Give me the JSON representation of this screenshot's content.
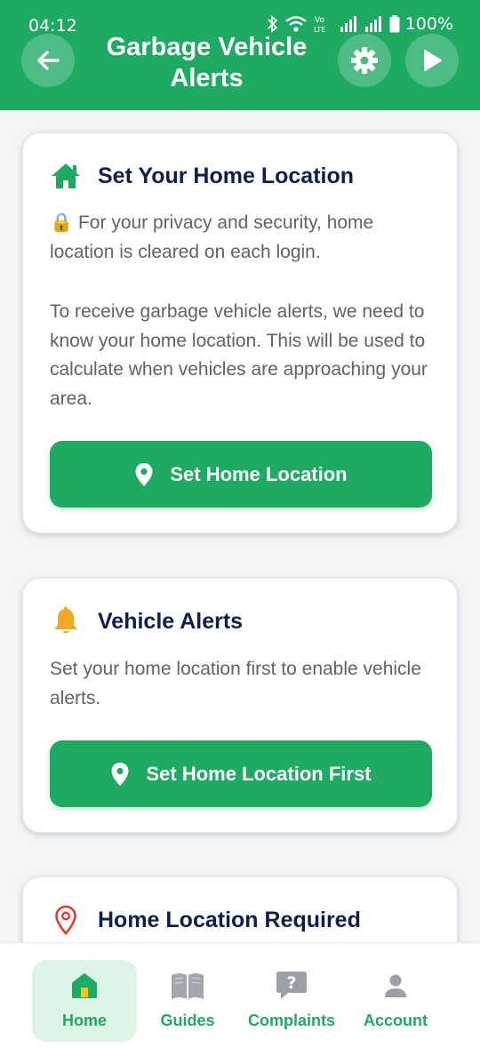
{
  "status_bar": {
    "time": "04:12",
    "battery": "100%",
    "icons": [
      "bluetooth-icon",
      "wifi-icon",
      "volte-icon",
      "signal-icon",
      "signal-icon",
      "battery-icon"
    ]
  },
  "header": {
    "title": "Garbage Vehicle Alerts",
    "back_icon": "arrow-left-icon",
    "settings_icon": "gear-icon",
    "play_icon": "play-icon",
    "background": "#1faa63"
  },
  "cards": {
    "home_location": {
      "icon": "home-icon",
      "title": "Set Your Home Location",
      "privacy_text": "🔒 For your privacy and security, home location is cleared on each login.",
      "description": "To receive garbage vehicle alerts, we need to know your home location. This will be used to calculate when vehicles are approaching your area.",
      "button_label": "Set Home Location"
    },
    "vehicle_alerts": {
      "icon": "bell-icon",
      "icon_color": "#f5a623",
      "title": "Vehicle Alerts",
      "description": "Set your home location first to enable vehicle alerts.",
      "button_label": "Set Home Location First"
    },
    "location_required": {
      "icon": "map-pin-icon",
      "icon_color": "#e53935",
      "title": "Home Location Required"
    }
  },
  "bottom_nav": {
    "items": [
      {
        "label": "Home",
        "icon": "home-icon",
        "active": true
      },
      {
        "label": "Guides",
        "icon": "book-icon",
        "active": false
      },
      {
        "label": "Complaints",
        "icon": "question-bubble-icon",
        "active": false
      },
      {
        "label": "Account",
        "icon": "person-icon",
        "active": false
      }
    ]
  },
  "colors": {
    "primary": "#1faa63",
    "title_text": "#0f1f4b",
    "body_text": "#5f6368",
    "active_nav_bg": "#dcf3e6",
    "inactive_icon": "#9aa0a6"
  }
}
